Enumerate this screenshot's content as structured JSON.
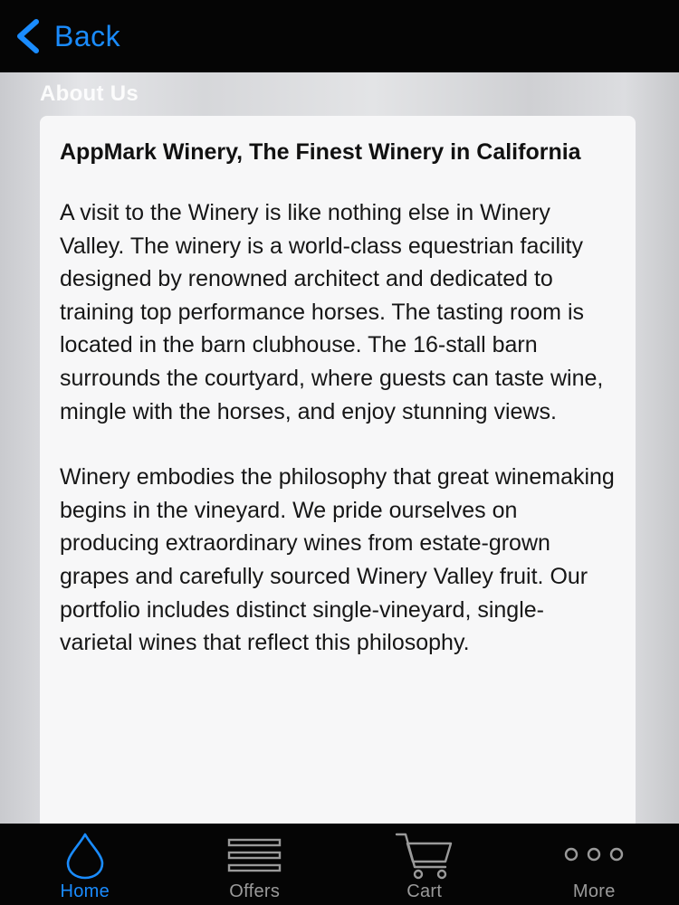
{
  "header": {
    "back_label": "Back"
  },
  "main": {
    "section_title": "About Us",
    "card": {
      "heading": "AppMark Winery, The Finest Winery in California",
      "paragraphs": [
        "A visit to the Winery is like nothing else in Winery Valley. The winery is a world-class equestrian facility designed by renowned architect and dedicated to training top performance horses. The tasting room is located in the barn clubhouse. The 16-stall barn surrounds the courtyard, where guests can taste wine, mingle with the horses, and enjoy stunning views.",
        "Winery embodies the philosophy that great winemaking begins in the vineyard. We pride ourselves on producing extraordinary wines from estate-grown grapes and carefully sourced Winery Valley fruit. Our portfolio includes distinct single-vineyard, single-varietal wines that reflect this philosophy."
      ]
    }
  },
  "tabbar": {
    "tabs": [
      {
        "label": "Home",
        "icon": "drop-icon",
        "active": true
      },
      {
        "label": "Offers",
        "icon": "list-icon",
        "active": false
      },
      {
        "label": "Cart",
        "icon": "cart-icon",
        "active": false
      },
      {
        "label": "More",
        "icon": "more-dots-icon",
        "active": false
      }
    ]
  },
  "colors": {
    "accent": "#1a8cff",
    "bar_background": "#050505",
    "inactive_tab": "#9a9a9a"
  }
}
